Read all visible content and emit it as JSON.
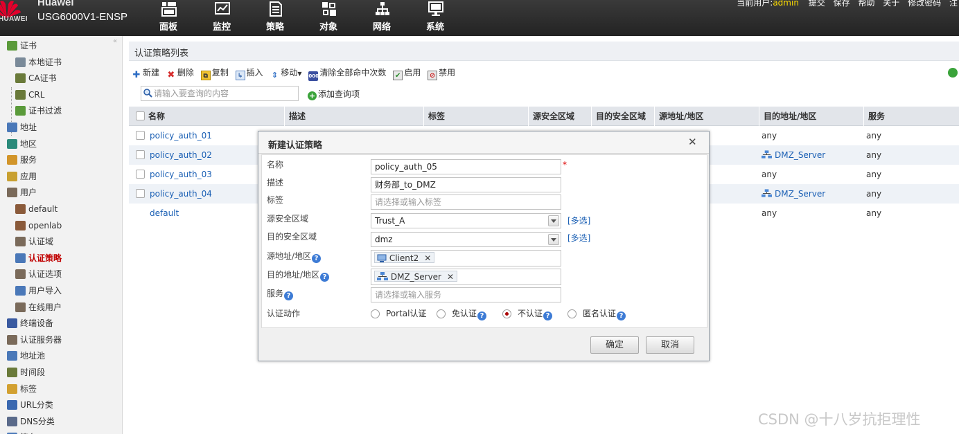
{
  "header": {
    "brand": "Huawei",
    "brand_word": "HUAWEI",
    "model": "USG6000V1-ENSP",
    "nav": [
      {
        "label": "面板",
        "icon": "dashboard-icon"
      },
      {
        "label": "监控",
        "icon": "monitor-chart-icon"
      },
      {
        "label": "策略",
        "icon": "policy-doc-icon"
      },
      {
        "label": "对象",
        "icon": "object-icon"
      },
      {
        "label": "网络",
        "icon": "network-icon"
      },
      {
        "label": "系统",
        "icon": "system-monitor-icon"
      }
    ],
    "current_user_label": "当前用户:",
    "current_user": "admin",
    "links": [
      "提交",
      "保存",
      "帮助",
      "关于",
      "修改密码",
      "注"
    ]
  },
  "sidebar": {
    "items": [
      {
        "label": "证书",
        "icon": "certificate-icon"
      },
      {
        "label": "本地证书",
        "icon": "local-cert-icon"
      },
      {
        "label": "CA证书",
        "icon": "ca-cert-icon"
      },
      {
        "label": "CRL",
        "icon": "crl-icon"
      },
      {
        "label": "证书过滤",
        "icon": "cert-filter-icon"
      },
      {
        "label": "地址",
        "icon": "address-icon"
      },
      {
        "label": "地区",
        "icon": "region-icon"
      },
      {
        "label": "服务",
        "icon": "service-icon"
      },
      {
        "label": "应用",
        "icon": "application-icon"
      },
      {
        "label": "用户",
        "icon": "user-icon"
      },
      {
        "label": "default",
        "icon": "user-group-icon"
      },
      {
        "label": "openlab",
        "icon": "user-group-icon"
      },
      {
        "label": "认证域",
        "icon": "auth-domain-icon"
      },
      {
        "label": "认证策略",
        "icon": "auth-policy-icon"
      },
      {
        "label": "认证选项",
        "icon": "auth-option-icon"
      },
      {
        "label": "用户导入",
        "icon": "user-import-icon"
      },
      {
        "label": "在线用户",
        "icon": "online-user-icon"
      },
      {
        "label": "终端设备",
        "icon": "terminal-device-icon"
      },
      {
        "label": "认证服务器",
        "icon": "auth-server-icon"
      },
      {
        "label": "地址池",
        "icon": "address-pool-icon"
      },
      {
        "label": "时间段",
        "icon": "time-range-icon"
      },
      {
        "label": "标签",
        "icon": "tag-icon"
      },
      {
        "label": "URL分类",
        "icon": "url-category-icon"
      },
      {
        "label": "DNS分类",
        "icon": "dns-category-icon"
      },
      {
        "label": "签名",
        "icon": "signature-icon"
      }
    ]
  },
  "page": {
    "title": "认证策略列表",
    "toolbar": [
      "新建",
      "删除",
      "复制",
      "插入",
      "移动",
      "清除全部命中次数",
      "启用",
      "禁用"
    ],
    "search_placeholder": "请输入要查询的内容",
    "add_query": "添加查询项",
    "columns": [
      "名称",
      "描述",
      "标签",
      "源安全区域",
      "目的安全区域",
      "源地址/地区",
      "目的地址/地区",
      "服务"
    ],
    "rows": [
      {
        "name": "policy_auth_01",
        "dst_addr": "any",
        "dst_addr_object": false,
        "service": "any"
      },
      {
        "name": "policy_auth_02",
        "dst_addr": "DMZ_Server",
        "dst_addr_object": true,
        "service": "any"
      },
      {
        "name": "policy_auth_03",
        "dst_addr": "any",
        "dst_addr_object": false,
        "service": "any"
      },
      {
        "name": "policy_auth_04",
        "dst_addr": "DMZ_Server",
        "dst_addr_object": true,
        "service": "any"
      },
      {
        "name": "default",
        "dst_addr": "any",
        "dst_addr_object": false,
        "service": "any"
      }
    ]
  },
  "dialog": {
    "title": "新建认证策略",
    "fields": {
      "name_label": "名称",
      "name_value": "policy_auth_05",
      "desc_label": "描述",
      "desc_value": "财务部_to_DMZ",
      "tag_label": "标签",
      "tag_placeholder": "请选择或输入标签",
      "src_zone_label": "源安全区域",
      "src_zone_value": "Trust_A",
      "dst_zone_label": "目的安全区域",
      "dst_zone_value": "dmz",
      "multi_select": "[多选]",
      "src_addr_label": "源地址/地区",
      "src_addr_tag": "Client2",
      "dst_addr_label": "目的地址/地区",
      "dst_addr_tag": "DMZ_Server",
      "service_label": "服务",
      "service_placeholder": "请选择或输入服务",
      "action_label": "认证动作"
    },
    "actions": [
      {
        "label": "Portal认证",
        "selected": false,
        "help": false
      },
      {
        "label": "免认证",
        "selected": false,
        "help": true
      },
      {
        "label": "不认证",
        "selected": true,
        "help": true
      },
      {
        "label": "匿名认证",
        "selected": false,
        "help": true
      }
    ],
    "ok": "确定",
    "cancel": "取消"
  },
  "watermark": "CSDN @十八岁抗拒理性",
  "colors": {
    "accent_red": "#c00000",
    "link_blue": "#1a5fb4",
    "user_yellow": "#ffde00"
  }
}
